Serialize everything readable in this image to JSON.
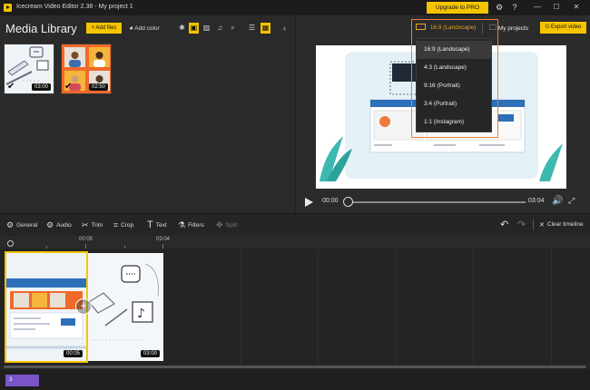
{
  "window": {
    "title": "Icecream Video Editor 2.38  -  My project 1",
    "upgrade_label": "Upgrade to PRO"
  },
  "library": {
    "title": "Media Library",
    "add_files_label": "+ Add files",
    "add_color_label": "Add color",
    "items": [
      {
        "duration": "03:00"
      },
      {
        "duration": "02:50"
      }
    ]
  },
  "preview": {
    "my_projects_label": "My projects",
    "export_label": "Export video",
    "time_current": "00:00",
    "time_total": "03:04"
  },
  "ratio": {
    "current": "16:9 (Landscape)",
    "options": [
      "16:9 (Landscape)",
      "4:3 (Landscape)",
      "9:16 (Portrait)",
      "3:4 (Portrait)",
      "1:1 (Instagram)"
    ]
  },
  "edit_toolbar": {
    "general": "General",
    "audio": "Audio",
    "trim": "Trim",
    "crop": "Crop",
    "text": "Text",
    "filters": "Filters",
    "split": "Split",
    "clear_timeline": "Clear timeline"
  },
  "timeline": {
    "ticks": [
      "00:05",
      "03:04"
    ],
    "clips": [
      {
        "duration": "00:05"
      },
      {
        "duration": "03:00"
      }
    ]
  },
  "status": {
    "track_label": "3"
  },
  "colors": {
    "accent": "#f5c400",
    "highlight_frame": "#f07b3a",
    "track_tag": "#7a55c7"
  }
}
